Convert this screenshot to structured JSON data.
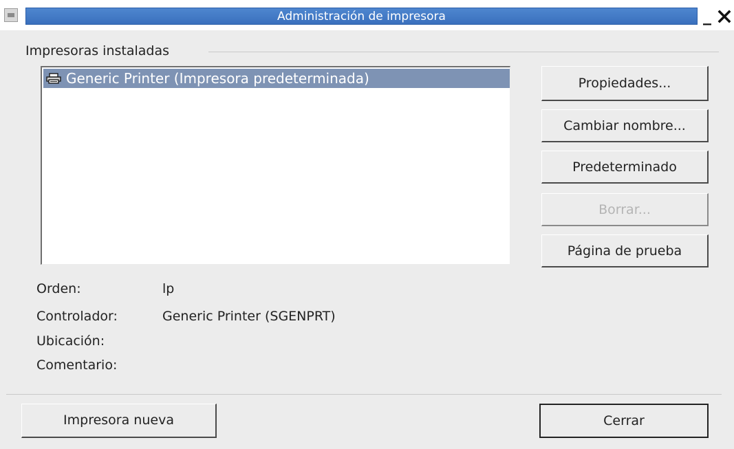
{
  "window": {
    "title": "Administración de impresora",
    "minimize_glyph": "_",
    "close_glyph": "✕"
  },
  "group": {
    "header": "Impresoras instaladas"
  },
  "printers": [
    {
      "label": "Generic Printer (Impresora predeterminada)",
      "icon": "printer-icon",
      "selected": true
    }
  ],
  "actions": {
    "properties": "Propiedades...",
    "rename": "Cambiar nombre...",
    "set_default": "Predeterminado",
    "delete": "Borrar...",
    "test_page": "Página de prueba"
  },
  "details": {
    "command_label": "Orden:",
    "command_value": "lp",
    "driver_label": "Controlador:",
    "driver_value": "Generic Printer (SGENPRT)",
    "location_label": "Ubicación:",
    "location_value": "",
    "comment_label": "Comentario:",
    "comment_value": ""
  },
  "footer": {
    "new_printer": "Impresora nueva",
    "close": "Cerrar"
  },
  "colors": {
    "titlebar": "#3a70bd",
    "selection": "#7e93b4",
    "window_bg": "#ececec"
  }
}
